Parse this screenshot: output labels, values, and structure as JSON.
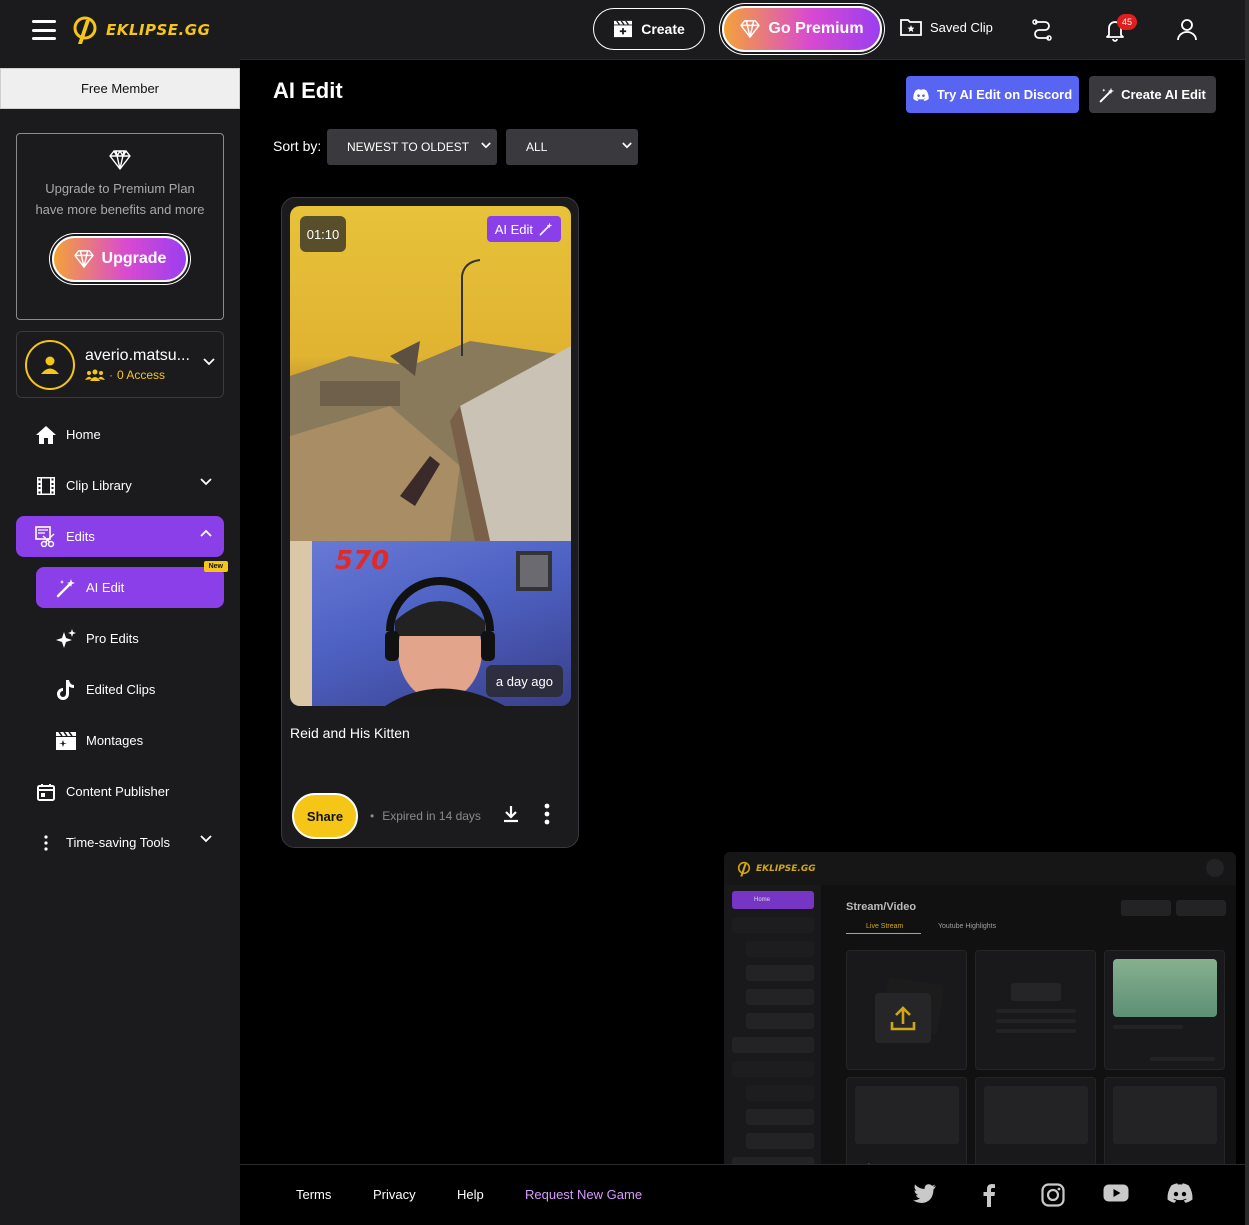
{
  "brand": {
    "name": "EKLIPSE.GG",
    "accent": "#f5c518",
    "purple": "#8b3fe8"
  },
  "sidebar": {
    "membership": "Free Member",
    "upgrade": {
      "text": "Upgrade to Premium Plan have more benefits and more",
      "button": "Upgrade"
    },
    "user": {
      "name": "averio.matsu...",
      "access": "0 Access"
    },
    "nav": {
      "home": "Home",
      "clip_library": "Clip Library",
      "edits": "Edits",
      "ai_edit": "AI Edit",
      "ai_edit_badge": "New",
      "pro_edits": "Pro Edits",
      "edited_clips": "Edited Clips",
      "montages": "Montages",
      "content_publisher": "Content Publisher",
      "time_saving_tools": "Time-saving Tools"
    }
  },
  "topbar": {
    "create": "Create",
    "go_premium": "Go Premium",
    "saved_clip": "Saved Clip",
    "notifications_count": "45"
  },
  "main": {
    "title": "AI Edit",
    "try_discord": "Try AI Edit on Discord",
    "create_ai_edit": "Create AI Edit",
    "sort_label": "Sort by:",
    "sort_value": "NEWEST TO OLDEST",
    "filter_value": "ALL"
  },
  "card": {
    "duration": "01:10",
    "badge": "AI Edit",
    "time_ago": "a day ago",
    "title": "Reid and His Kitten",
    "share": "Share",
    "expire": "Expired in 14 days"
  },
  "preview": {
    "logo": "EKLIPSE.GG",
    "home": "Home",
    "title": "Stream/Video",
    "tab_live": "Live Stream",
    "tab_youtube": "Youtube Highlights"
  },
  "footer": {
    "terms": "Terms",
    "privacy": "Privacy",
    "help": "Help",
    "request_game": "Request New Game"
  }
}
